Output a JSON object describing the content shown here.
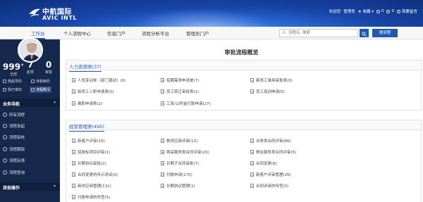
{
  "brand": {
    "name_cn": "中航国际",
    "name_en": "AVIC INTL"
  },
  "top_links": [
    {
      "label": "欢迎您",
      "icon": "user-icon"
    },
    {
      "label": "管理员",
      "icon": "chevron-down-icon"
    },
    {
      "label": "★ 收藏 ▾",
      "icon": "star-icon"
    },
    {
      "label": "0",
      "icon": "message-icon"
    },
    {
      "label": "0",
      "icon": "bell-icon"
    },
    {
      "label": "我要留言",
      "icon": "comment-icon"
    }
  ],
  "nav": {
    "items": [
      "工作台",
      "个人流程中心",
      "信息门户",
      "流程分析平台",
      "管理员门户"
    ],
    "search_placeholder": "人, 流程名, 搜索",
    "search_flow_label": "搜流程"
  },
  "sidebar": {
    "stats": [
      {
        "value": "999",
        "sup": "+",
        "label": "全部"
      },
      {
        "value": "7",
        "sup": "",
        "label": "起草"
      },
      {
        "value": "0",
        "sup": "",
        "label": "审批"
      }
    ],
    "quick": [
      "我起草的",
      "待我审的",
      "我已审的",
      "流程概况"
    ],
    "section_business": "业务导航",
    "items": [
      "所有流程",
      "流程发起",
      "流程审核",
      "流程跟踪",
      "流程反馈",
      "流程查询"
    ],
    "section_other": "其他操作"
  },
  "main": {
    "title": "审批流程概览",
    "hr": {
      "title": "人力资源类(37)",
      "items": [
        "人员变动单（部门调动）(0)",
        "招聘需求申请单(7)",
        "新员工录用审批表(0)",
        "新员工入职申请表(0)",
        "员工转正审批表(1)",
        "员工培训申请(0)",
        "离职申请表(2)",
        "工资/公积金打款申请(27)"
      ]
    },
    "ops": {
      "title": "经营管理类(495)",
      "items": [
        "新客户评审(16)",
        "数供应商评审(12)",
        "业务类合同评审(86)",
        "招投标项目评审(1)",
        "购采服务类合同评审(20)",
        "物业服务类合同评审(5)",
        "长期协议审批(2)",
        "长期子合同审批(7)",
        "合同变更(6)",
        "合同变更的传示测试(0)",
        "付款申请(175)",
        "新客户评审管理(26)",
        "新供应商管理(131)",
        "长期协议管理(1)",
        "合同评审的传签(0)",
        "付款申请的传签(5)"
      ]
    }
  }
}
